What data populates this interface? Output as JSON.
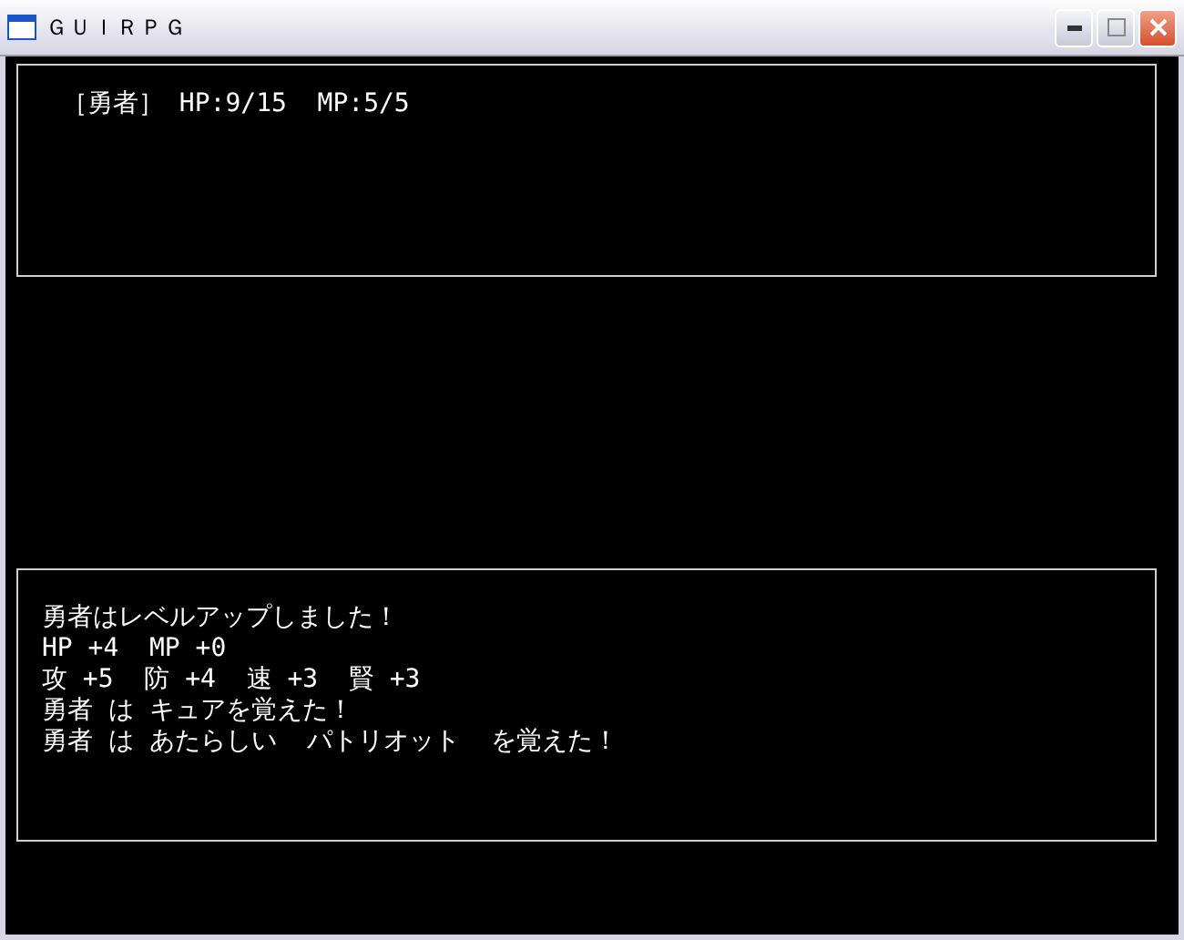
{
  "window": {
    "title": "ＧＵＩＲＰＧ"
  },
  "status": {
    "text": "［勇者］ HP:9/15  MP:5/5"
  },
  "messages": [
    "勇者はレベルアップしました！",
    "HP +4  MP +0",
    "攻 +5  防 +4  速 +3  賢 +3",
    "勇者 は キュアを覚えた！",
    "勇者 は あたらしい  パトリオット  を覚えた！"
  ]
}
